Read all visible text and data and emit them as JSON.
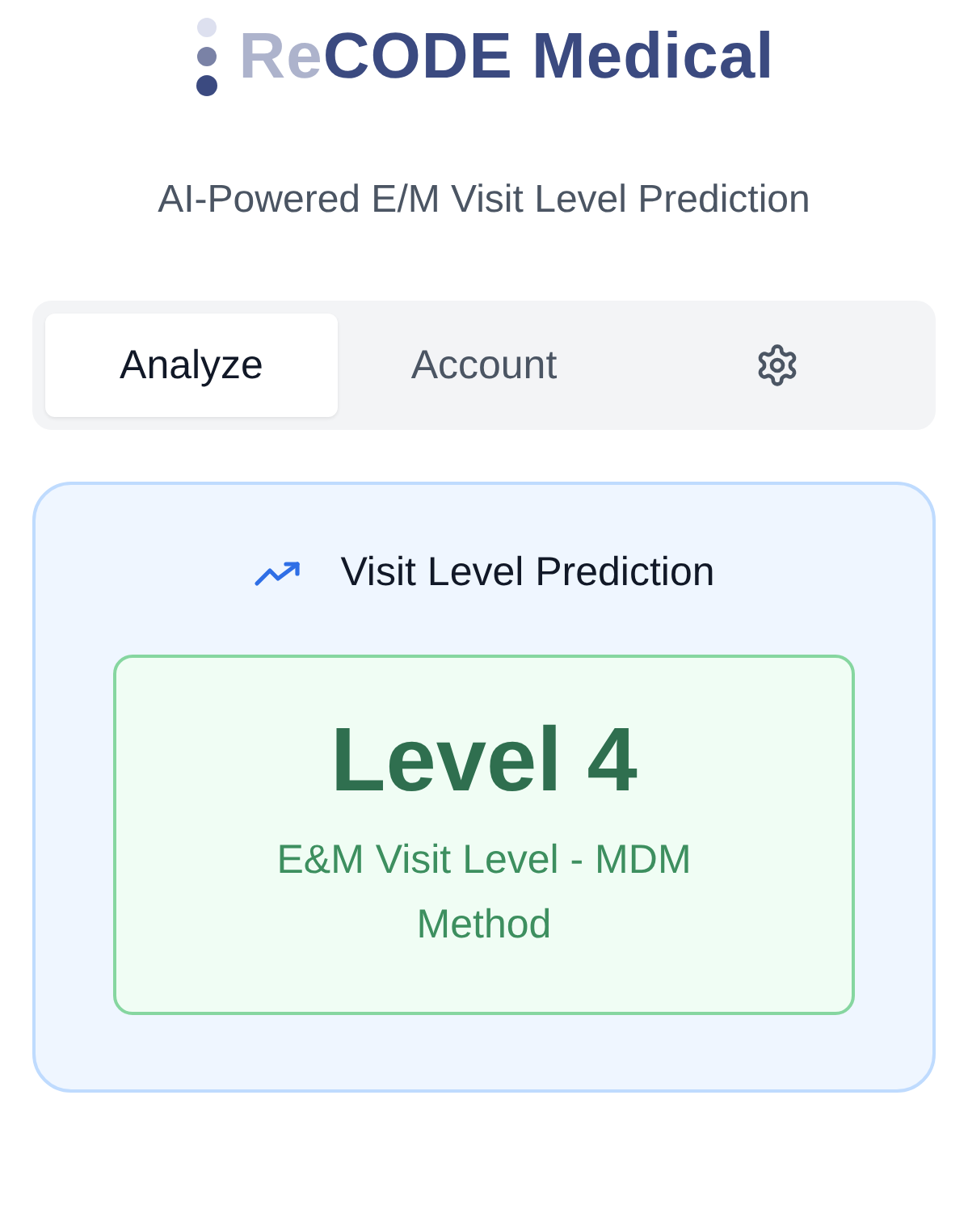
{
  "logo": {
    "prefix": "Re",
    "rest": "CODE Medical"
  },
  "subtitle": "AI-Powered E/M Visit Level Prediction",
  "tabs": [
    {
      "kind": "text",
      "label": "Analyze",
      "selected": true
    },
    {
      "kind": "text",
      "label": "Account",
      "selected": false
    },
    {
      "kind": "settings",
      "selected": false
    }
  ],
  "prediction": {
    "title": "Visit Level Prediction",
    "level": "Level 4",
    "description": "E&M Visit Level - MDM Method"
  }
}
